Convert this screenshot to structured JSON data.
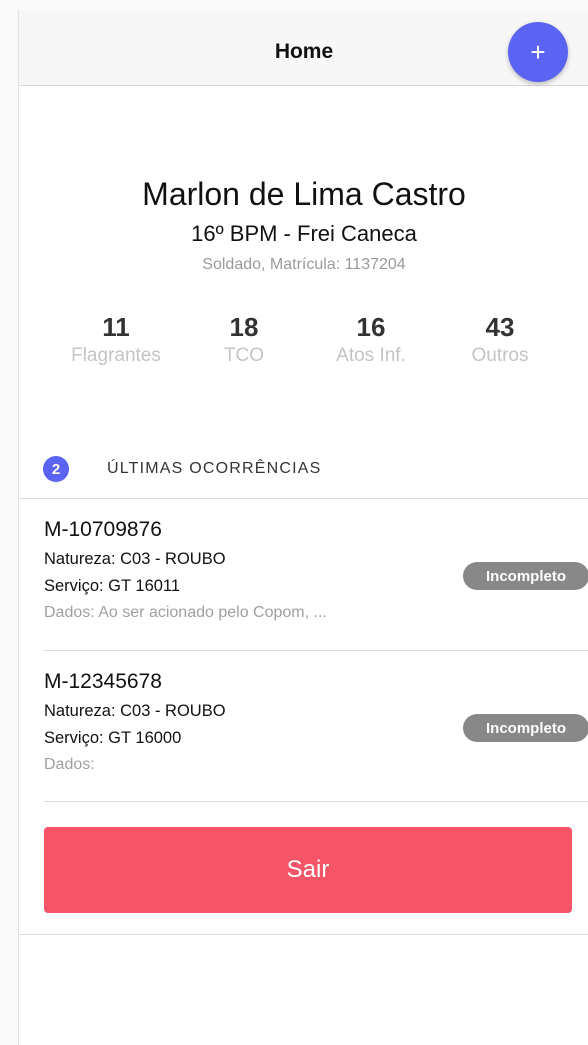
{
  "header": {
    "title": "Home",
    "add_icon": "+"
  },
  "profile": {
    "name": "Marlon de Lima Castro",
    "unit": "16º BPM - Frei Caneca",
    "rank": "Soldado, Matrícula: 1137204"
  },
  "stats": [
    {
      "value": "11",
      "label": "Flagrantes"
    },
    {
      "value": "18",
      "label": "TCO"
    },
    {
      "value": "16",
      "label": "Atos Inf."
    },
    {
      "value": "43",
      "label": "Outros"
    }
  ],
  "section": {
    "count": "2",
    "title": "ÚLTIMAS OCORRÊNCIAS"
  },
  "occurrences": [
    {
      "id": "M-10709876",
      "natureza": "Natureza: C03 - ROUBO",
      "servico": "Serviço: GT 16011",
      "dados": "Dados: Ao ser acionado pelo Copom, ...",
      "status": "Incompleto"
    },
    {
      "id": "M-12345678",
      "natureza": "Natureza: C03 - ROUBO",
      "servico": "Serviço: GT 16000",
      "dados": "Dados:",
      "status": "Incompleto"
    }
  ],
  "logout_label": "Sair",
  "colors": {
    "accent": "#5b63f2",
    "danger": "#f55566",
    "status_badge": "#888888"
  }
}
